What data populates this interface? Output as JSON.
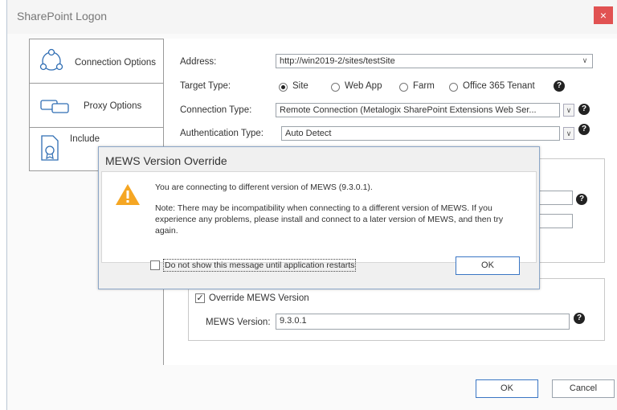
{
  "window": {
    "title": "SharePoint Logon",
    "close_glyph": "×"
  },
  "tabs": [
    {
      "label": "Connection Options",
      "icon": "connection-nodes-icon"
    },
    {
      "label": "Proxy Options",
      "icon": "proxy-links-icon"
    },
    {
      "label": "Include",
      "icon": "certificate-icon"
    }
  ],
  "form": {
    "address_label": "Address:",
    "address_value": "http://win2019-2/sites/testSite",
    "target_type_label": "Target Type:",
    "target_options": [
      "Site",
      "Web App",
      "Farm",
      "Office 365 Tenant"
    ],
    "target_selected": "Site",
    "connection_type_label": "Connection Type:",
    "connection_type_value": "Remote Connection (Metalogix SharePoint Extensions Web Ser...",
    "auth_type_label": "Authentication Type:",
    "auth_type_value": "Auto Detect",
    "help_glyph": "?",
    "dropdown_glyph": "∨"
  },
  "mews": {
    "override_label": "Override MEWS Version",
    "override_checked": true,
    "version_label": "MEWS Version:",
    "version_value": "9.3.0.1"
  },
  "footer": {
    "ok_label": "OK",
    "cancel_label": "Cancel"
  },
  "dialog": {
    "title": "MEWS Version Override",
    "message": "You are connecting to different version of MEWS (9.3.0.1).",
    "note": "Note: There may be incompatibility when connecting to a different version of MEWS. If you experience any problems, please install and connect to a later version of MEWS, and then try again.",
    "checkbox_label": "Do not show this message until application restarts",
    "checkbox_checked": false,
    "ok_label": "OK",
    "warning_color": "#f5a623"
  }
}
